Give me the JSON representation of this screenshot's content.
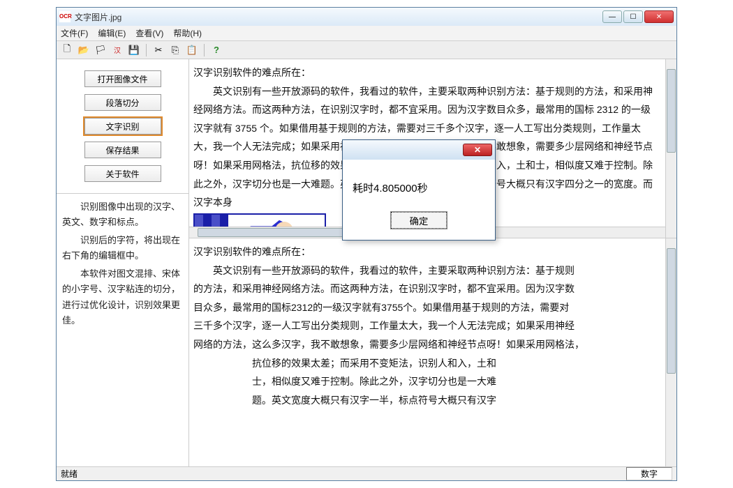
{
  "window": {
    "app_icon_text": "OCR",
    "title": "文字图片.jpg"
  },
  "menu": {
    "file": "文件(F)",
    "edit": "编辑(E)",
    "view": "查看(V)",
    "help": "帮助(H)"
  },
  "toolbar_icons": {
    "new": "🗋",
    "open": "📂",
    "flag": "🏳",
    "ocr": "汉",
    "save": "💾",
    "cut": "✂",
    "copy": "⎘",
    "paste": "📋",
    "about": "?"
  },
  "sidebar": {
    "buttons": [
      {
        "label": "打开图像文件",
        "selected": false
      },
      {
        "label": "段落切分",
        "selected": false
      },
      {
        "label": "文字识别",
        "selected": true
      },
      {
        "label": "保存结果",
        "selected": false
      },
      {
        "label": "关于软件",
        "selected": false
      }
    ],
    "info": {
      "p1": "识别图像中出现的汉字、英文、数字和标点。",
      "p2": "识别后的字符，将出现在右下角的编辑框中。",
      "p3": "本软件对图文混排、宋体的小字号、汉字粘连的切分，进行过优化设计，识别效果更佳。"
    }
  },
  "pane_top": {
    "heading": "汉字识别软件的难点所在：",
    "body": "英文识别有一些开放源码的软件，我看过的软件，主要采取两种识别方法：基于规则的方法，和采用神经网络方法。而这两种方法，在识别汉字时，都不宜采用。因为汉字数目众多，最常用的国标 2312 的一级汉字就有 3755 个。如果借用基于规则的方法，需要对三千多个汉字，逐一人工写出分类规则，工作量太大，我一个人无法完成；如果采用神经网络的方法，这么多汉字，我不敢想象，需要多少层网络和神经节点呀！如果采用网格法，抗位移的效果太差；而采用不变矩法，识别人和入，土和士，相似度又难于控制。除此之外，汉字切分也是一大难题。英文宽度大概只有汉字一半，标点符号大概只有汉字四分之一的宽度。而汉字本身"
  },
  "pane_bottom": {
    "heading": "汉字识别软件的难点所在：",
    "lines": [
      "英文识别有一些开放源码的软件，我看过的软件，主要采取两种识别方法：基于规则",
      "的方法，和采用神经网络方法。而这两种方法，在识别汉字时，都不宜采用。因为汉字数",
      "目众多，最常用的国标2312的一级汉字就有3755个。如果借用基于规则的方法，需要对",
      "三千多个汉字，逐一人工写出分类规则，工作量太大，我一个人无法完成；如果采用神经",
      "网络的方法，这么多汉字，我不敢想象，需要多少层网络和神经节点呀！如果采用网格法，",
      "抗位移的效果太差；而采用不变矩法，识别人和入，土和",
      "士，相似度又难于控制。除此之外，汉字切分也是一大难",
      "题。英文宽度大概只有汉字一半，标点符号大概只有汉字"
    ]
  },
  "dialog": {
    "message": "耗时4.805000秒",
    "ok": "确定"
  },
  "statusbar": {
    "left": "就绪",
    "right": "数字"
  }
}
